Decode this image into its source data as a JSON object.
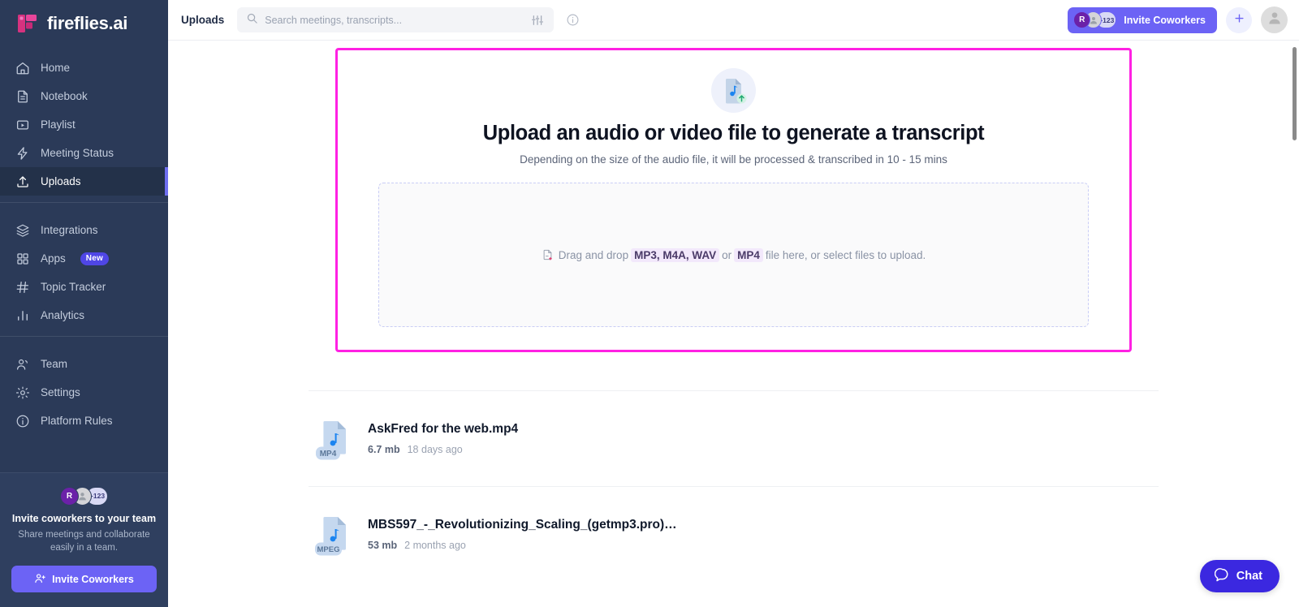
{
  "brand": {
    "name": "fireflies.ai",
    "logo_icon": "fireflies-logo-icon",
    "accent": "#6c63f5",
    "logo_color": "#e0368f",
    "sidebar_bg": "#2b3a58",
    "highlight_border": "#ff21e3"
  },
  "sidebar": {
    "groups": [
      {
        "items": [
          {
            "label": "Home",
            "icon": "home-icon",
            "active": false
          },
          {
            "label": "Notebook",
            "icon": "notebook-icon",
            "active": false
          },
          {
            "label": "Playlist",
            "icon": "playlist-icon",
            "active": false
          },
          {
            "label": "Meeting Status",
            "icon": "lightning-icon",
            "active": false
          },
          {
            "label": "Uploads",
            "icon": "upload-icon",
            "active": true
          }
        ]
      },
      {
        "items": [
          {
            "label": "Integrations",
            "icon": "layers-icon",
            "active": false
          },
          {
            "label": "Apps",
            "icon": "grid-icon",
            "active": false,
            "badge": "New"
          },
          {
            "label": "Topic Tracker",
            "icon": "hash-icon",
            "active": false
          },
          {
            "label": "Analytics",
            "icon": "bar-chart-icon",
            "active": false
          }
        ]
      },
      {
        "items": [
          {
            "label": "Team",
            "icon": "people-icon",
            "active": false
          },
          {
            "label": "Settings",
            "icon": "gear-icon",
            "active": false
          },
          {
            "label": "Platform Rules",
            "icon": "info-circle-icon",
            "active": false
          }
        ]
      }
    ],
    "invite_card": {
      "avatars": [
        "R",
        "",
        "+123"
      ],
      "title": "Invite coworkers to your team",
      "subtitle": "Share meetings and collaborate easily in a team.",
      "button_label": "Invite Coworkers",
      "button_icon": "person-add-icon"
    }
  },
  "topbar": {
    "page_title": "Uploads",
    "search": {
      "placeholder": "Search meetings, transcripts...",
      "value": "",
      "icon": "search-icon",
      "filter_icon": "sliders-icon"
    },
    "info_icon": "info-circle-icon",
    "invite_button": {
      "label": "Invite Coworkers",
      "avatars": [
        "R",
        "",
        "+123"
      ]
    },
    "add_button_icon": "plus-icon",
    "user_avatar_icon": "user-avatar-icon"
  },
  "upload_card": {
    "icon": "audio-file-upload-icon",
    "heading": "Upload an audio or video file to generate a transcript",
    "subheading": "Depending on the size of the audio file, it will be processed & transcribed in 10 - 15 mins",
    "dropzone": {
      "icon": "file-add-icon",
      "text_before": "Drag and drop",
      "formats_primary": "MP3, M4A, WAV",
      "text_or": "or",
      "formats_secondary": "MP4",
      "text_after": "file here, or select files to upload."
    }
  },
  "file_list": [
    {
      "name": "AskFred for the web.mp4",
      "size": "6.7 mb",
      "age": "18 days ago",
      "type_label": "MP4",
      "icon": "audio-file-icon"
    },
    {
      "name": "MBS597_-_Revolutionizing_Scaling_(getmp3.pro)…",
      "size": "53 mb",
      "age": "2 months ago",
      "type_label": "MPEG",
      "icon": "audio-file-icon"
    }
  ],
  "chat_widget": {
    "label": "Chat",
    "icon": "chat-bubble-icon"
  }
}
